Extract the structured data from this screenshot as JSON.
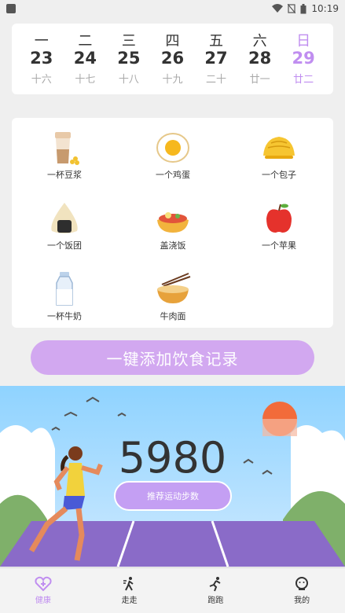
{
  "status_bar": {
    "time": "10:19"
  },
  "calendar": {
    "days": [
      {
        "weekday": "一",
        "date": "23",
        "lunar": "十六"
      },
      {
        "weekday": "二",
        "date": "24",
        "lunar": "十七"
      },
      {
        "weekday": "三",
        "date": "25",
        "lunar": "十八"
      },
      {
        "weekday": "四",
        "date": "26",
        "lunar": "十九"
      },
      {
        "weekday": "五",
        "date": "27",
        "lunar": "二十"
      },
      {
        "weekday": "六",
        "date": "28",
        "lunar": "廿一"
      },
      {
        "weekday": "日",
        "date": "29",
        "lunar": "廿二"
      }
    ],
    "highlight_color": "#c08ef0"
  },
  "foods": [
    {
      "label": "一杯豆浆",
      "icon": "soy-milk-cup-icon"
    },
    {
      "label": "一个鸡蛋",
      "icon": "fried-egg-icon"
    },
    {
      "label": "一个包子",
      "icon": "steamed-bun-icon"
    },
    {
      "label": "一个饭团",
      "icon": "rice-ball-icon"
    },
    {
      "label": "盖浇饭",
      "icon": "rice-bowl-icon"
    },
    {
      "label": "一个苹果",
      "icon": "apple-icon"
    },
    {
      "label": "一杯牛奶",
      "icon": "milk-bottle-icon"
    },
    {
      "label": "牛肉面",
      "icon": "beef-noodle-icon"
    }
  ],
  "add_record_button": {
    "label": "一键添加饮食记录",
    "color": "#d2a8f0"
  },
  "exercise": {
    "steps": "5980",
    "recommend_label": "推荐运动步数"
  },
  "tab_bar": {
    "tabs": [
      {
        "label": "健康",
        "icon": "heart-plus-icon",
        "active": true
      },
      {
        "label": "走走",
        "icon": "walking-icon",
        "active": false
      },
      {
        "label": "跑跑",
        "icon": "running-icon",
        "active": false
      },
      {
        "label": "我的",
        "icon": "user-face-icon",
        "active": false
      }
    ],
    "active_color": "#c08ef0"
  }
}
